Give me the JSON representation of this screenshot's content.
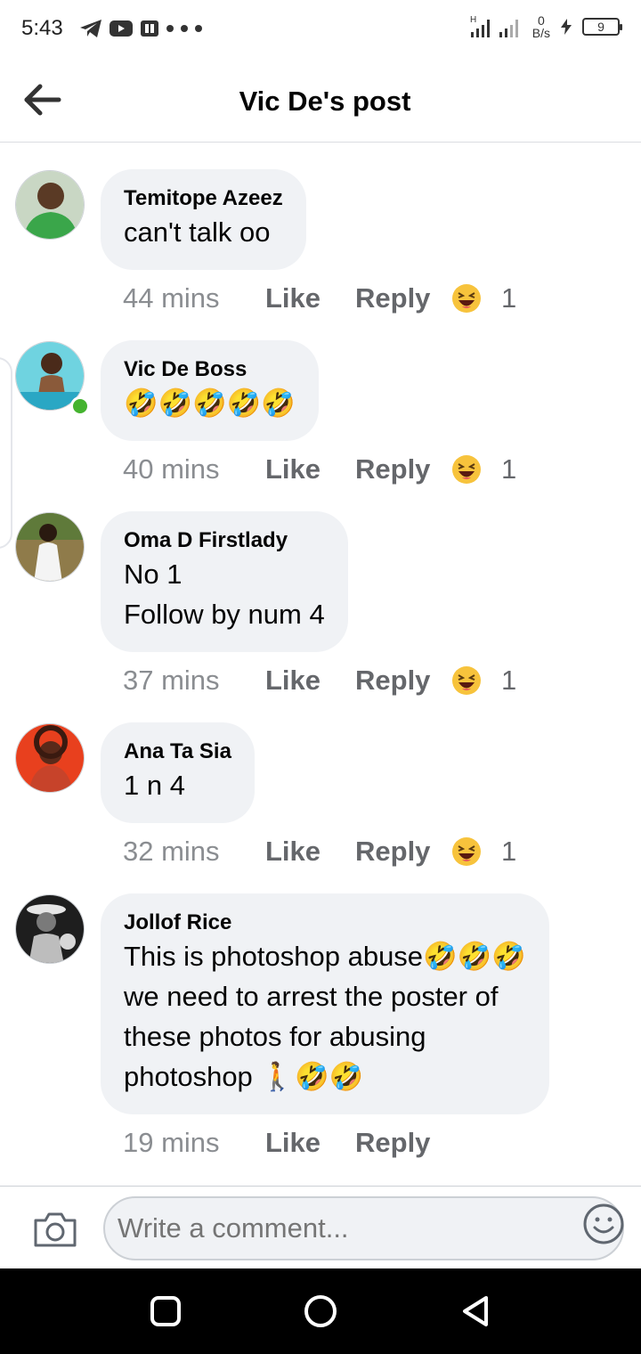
{
  "status_bar": {
    "time": "5:43",
    "net_speed_value": "0",
    "net_speed_unit": "B/s",
    "battery": "9",
    "signal_label": "H"
  },
  "header": {
    "title": "Vic De's post"
  },
  "comments": [
    {
      "author": "Temitope Azeez",
      "lines": [
        "can't talk oo"
      ],
      "time": "44 mins",
      "like": "Like",
      "reply": "Reply",
      "reaction_icon": "laughing-squint-emoji",
      "reaction_count": "1",
      "avatar_color": "#3aa64a",
      "online": false
    },
    {
      "author": "Vic De Boss",
      "lines": [
        "🤣🤣🤣🤣🤣"
      ],
      "time": "40 mins",
      "like": "Like",
      "reply": "Reply",
      "reaction_icon": "laughing-squint-emoji",
      "reaction_count": "1",
      "avatar_color": "#49c6d6",
      "online": true
    },
    {
      "author": "Oma D Firstlady",
      "lines": [
        "No 1",
        "Follow by num 4"
      ],
      "time": "37 mins",
      "like": "Like",
      "reply": "Reply",
      "reaction_icon": "laughing-squint-emoji",
      "reaction_count": "1",
      "avatar_color": "#7a6a3c",
      "online": false
    },
    {
      "author": "Ana Ta Sia",
      "lines": [
        "1 n 4"
      ],
      "time": "32 mins",
      "like": "Like",
      "reply": "Reply",
      "reaction_icon": "laughing-squint-emoji",
      "reaction_count": "1",
      "avatar_color": "#e0361c",
      "online": false
    },
    {
      "author": "Jollof Rice",
      "lines": [
        "This is photoshop abuse🤣🤣🤣",
        "we need to arrest the poster of",
        "these photos for abusing",
        "photoshop 🚶🤣🤣"
      ],
      "time": "19 mins",
      "like": "Like",
      "reply": "Reply",
      "reaction_icon": "",
      "reaction_count": "",
      "avatar_color": "#3b3b3b",
      "online": false
    }
  ],
  "composer": {
    "placeholder": "Write a comment..."
  },
  "colors": {
    "bubble": "#f0f2f5",
    "meta_text": "#65676b",
    "online": "#44b32f"
  }
}
